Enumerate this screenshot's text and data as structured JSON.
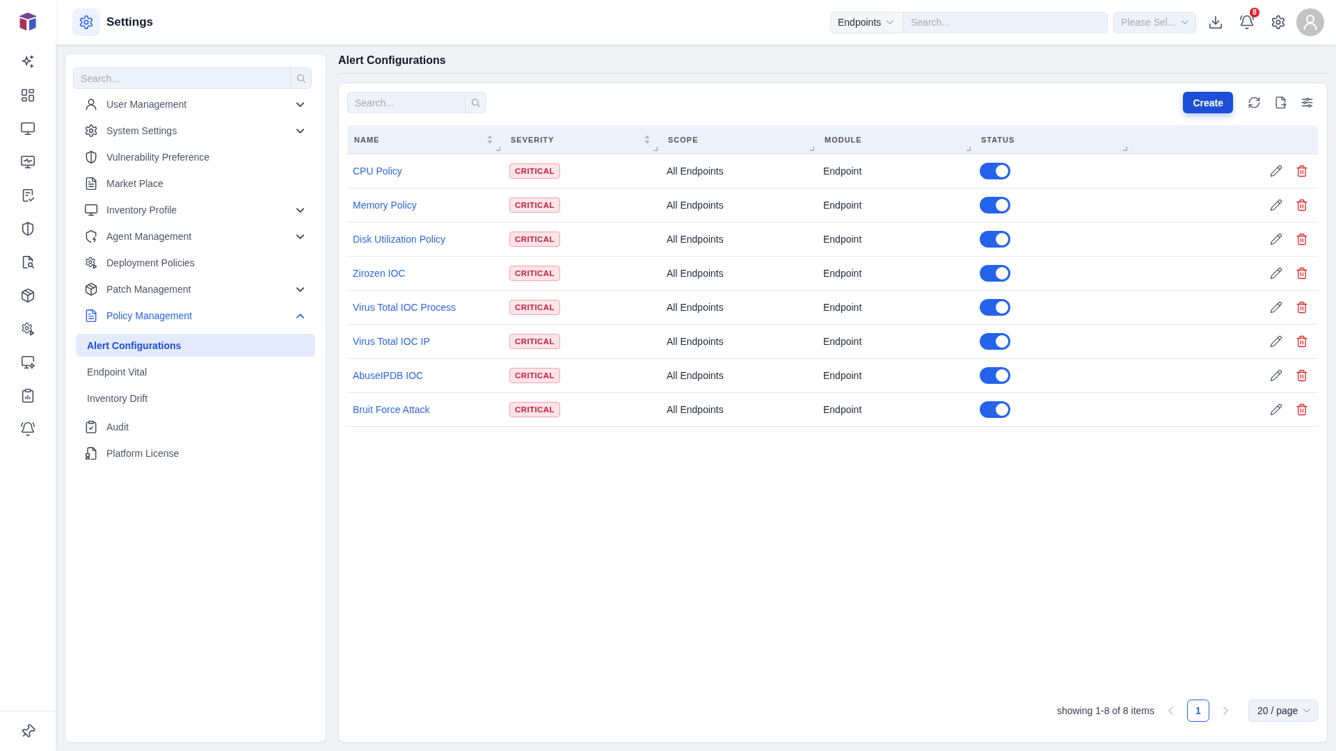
{
  "top_bar": {
    "title": "Settings",
    "scope_dropdown": {
      "value": "Endpoints"
    },
    "search": {
      "placeholder": "Search..."
    },
    "filter_dropdown": {
      "placeholder": "Please Sel..."
    },
    "notifications": {
      "count": "8"
    }
  },
  "settings_nav": {
    "search": {
      "placeholder": "Search..."
    },
    "items": [
      {
        "label": "User Management",
        "kind": "group",
        "selected": false,
        "expanded": false
      },
      {
        "label": "System Settings",
        "kind": "group",
        "selected": false,
        "expanded": false
      },
      {
        "label": "Vulnerability Preference",
        "kind": "link",
        "selected": false
      },
      {
        "label": "Market Place",
        "kind": "link",
        "selected": false
      },
      {
        "label": "Inventory Profile",
        "kind": "group",
        "selected": false,
        "expanded": false
      },
      {
        "label": "Agent Management",
        "kind": "group",
        "selected": false,
        "expanded": false
      },
      {
        "label": "Deployment Policies",
        "kind": "link",
        "selected": false
      },
      {
        "label": "Patch Management",
        "kind": "group",
        "selected": false,
        "expanded": false
      },
      {
        "label": "Policy Management",
        "kind": "group",
        "selected": true,
        "expanded": true,
        "children": [
          {
            "label": "Alert Configurations",
            "selected": true
          },
          {
            "label": "Endpoint Vital",
            "selected": false
          },
          {
            "label": "Inventory Drift",
            "selected": false
          }
        ]
      },
      {
        "label": "Audit",
        "kind": "link",
        "selected": false
      },
      {
        "label": "Platform License",
        "kind": "link",
        "selected": false
      }
    ]
  },
  "content": {
    "title": "Alert Configurations",
    "table": {
      "search": {
        "placeholder": "Search..."
      },
      "create_button": "Create",
      "columns": [
        {
          "label": "NAME",
          "sortable": true
        },
        {
          "label": "SEVERITY",
          "sortable": true
        },
        {
          "label": "SCOPE",
          "sortable": false
        },
        {
          "label": "MODULE",
          "sortable": false
        },
        {
          "label": "STATUS",
          "sortable": false
        }
      ],
      "rows": [
        {
          "name": "CPU Policy",
          "severity": "CRITICAL",
          "scope": "All Endpoints",
          "module": "Endpoint",
          "enabled": true
        },
        {
          "name": "Memory Policy",
          "severity": "CRITICAL",
          "scope": "All Endpoints",
          "module": "Endpoint",
          "enabled": true
        },
        {
          "name": "Disk Utilization Policy",
          "severity": "CRITICAL",
          "scope": "All Endpoints",
          "module": "Endpoint",
          "enabled": true
        },
        {
          "name": "Zirozen IOC",
          "severity": "CRITICAL",
          "scope": "All Endpoints",
          "module": "Endpoint",
          "enabled": true
        },
        {
          "name": "Virus Total IOC Process",
          "severity": "CRITICAL",
          "scope": "All Endpoints",
          "module": "Endpoint",
          "enabled": true
        },
        {
          "name": "Virus Total IOC IP",
          "severity": "CRITICAL",
          "scope": "All Endpoints",
          "module": "Endpoint",
          "enabled": true
        },
        {
          "name": "AbuseIPDB IOC",
          "severity": "CRITICAL",
          "scope": "All Endpoints",
          "module": "Endpoint",
          "enabled": true
        },
        {
          "name": "Bruit Force Attack",
          "severity": "CRITICAL",
          "scope": "All Endpoints",
          "module": "Endpoint",
          "enabled": true
        }
      ]
    },
    "pagination": {
      "summary": "showing 1-8 of 8 items",
      "previous_disabled": true,
      "next_disabled": true,
      "pages": [
        {
          "label": "1",
          "selected": true
        }
      ],
      "page_size": "20 / page"
    }
  }
}
